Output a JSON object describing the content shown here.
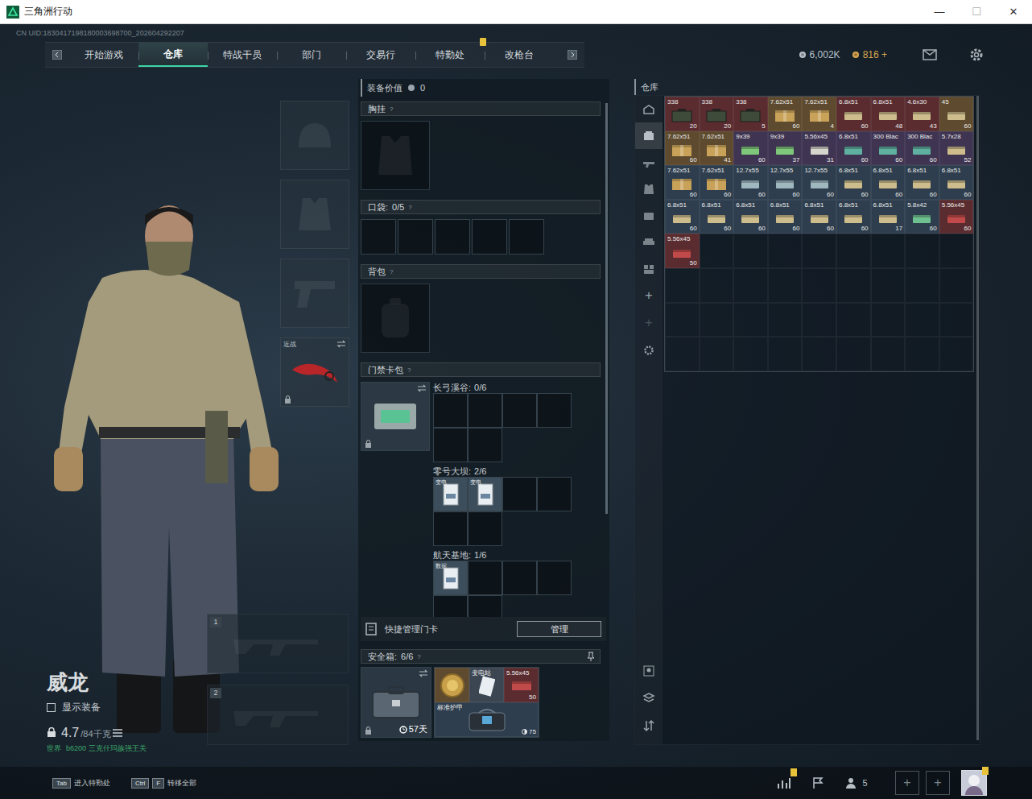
{
  "window": {
    "title": "三角洲行动",
    "controls": {
      "minimize": "—",
      "maximize": "☐",
      "close": "✕"
    }
  },
  "uid": "CN UID:1830417198180003698700_202604292207",
  "nav": {
    "tabs": [
      {
        "label": "开始游戏",
        "selected": false,
        "badge": false
      },
      {
        "label": "仓库",
        "selected": true,
        "badge": false
      },
      {
        "label": "特战干员",
        "selected": false,
        "badge": false
      },
      {
        "label": "部门",
        "selected": false,
        "badge": false
      },
      {
        "label": "交易行",
        "selected": false,
        "badge": false
      },
      {
        "label": "特勤处",
        "selected": false,
        "badge": true
      },
      {
        "label": "改枪台",
        "selected": false,
        "badge": false
      }
    ],
    "currency": [
      {
        "value": "6,002K",
        "color": "#b8c0c8"
      },
      {
        "value": "816 +",
        "color": "#d8a850"
      }
    ]
  },
  "character": {
    "name": "威龙",
    "show_equipment": {
      "label": "显示装备",
      "checked": false
    },
    "weight": "4.7",
    "weight_max": "/84千克",
    "status": {
      "channel": "世界",
      "text": "b6200 三克什玛族强王关"
    },
    "melee": {
      "label": "近战"
    },
    "weapon_slots": [
      "1",
      "2"
    ]
  },
  "loadout": {
    "value_label": "装备价值",
    "value": "0",
    "chest": {
      "label": "胸挂",
      "help": "?"
    },
    "pockets": {
      "label": "口袋:",
      "count": "0/5",
      "help": "?",
      "slots": [
        {
          "filled": false
        },
        {
          "filled": false
        },
        {
          "filled": false
        },
        {
          "filled": false
        },
        {
          "filled": false
        }
      ]
    },
    "backpack": {
      "label": "背包",
      "help": "?"
    },
    "keycards": {
      "label": "门禁卡包",
      "help": "?",
      "maps": [
        {
          "name": "长弓溪谷:",
          "count": "0/6",
          "cards": []
        },
        {
          "name": "零号大坝:",
          "count": "2/6",
          "cards": [
            {
              "label": "变电"
            },
            {
              "label": "变电"
            }
          ]
        },
        {
          "name": "航天基地:",
          "count": "1/6",
          "cards": [
            {
              "label": "数据"
            }
          ]
        }
      ]
    },
    "quick_manage": {
      "label": "快捷管理门卡",
      "button": "管理"
    },
    "safebox": {
      "label": "安全箱:",
      "count": "6/6",
      "help": "?",
      "duration": "57天",
      "items": [
        {
          "kind": "medal"
        },
        {
          "kind": "card",
          "label": "变电站"
        },
        {
          "kind": "ammo",
          "label": "5.56x45",
          "count": "50",
          "color": "#c04a4a"
        },
        {
          "kind": "armor",
          "label": "标准护甲",
          "count": "75"
        }
      ]
    }
  },
  "warehouse": {
    "title": "仓库",
    "sidebar": [
      {
        "selected": false
      },
      {
        "selected": true
      },
      {
        "selected": false
      },
      {
        "selected": false
      },
      {
        "selected": false
      },
      {
        "selected": false
      },
      {
        "selected": false
      }
    ],
    "add_buttons": [
      {
        "glyph": "+",
        "disabled": false
      },
      {
        "glyph": "+",
        "disabled": true
      }
    ],
    "items": [
      {
        "label": "338",
        "count": "20",
        "rarity": "red",
        "kind": "can",
        "color": "#3e4a3a"
      },
      {
        "label": "338",
        "count": "20",
        "rarity": "red",
        "kind": "can",
        "color": "#3e4a3a"
      },
      {
        "label": "338",
        "count": "5",
        "rarity": "red",
        "kind": "can",
        "color": "#3e4a3a"
      },
      {
        "label": "7.62x51",
        "count": "60",
        "rarity": "gold",
        "kind": "crate",
        "color": "#c9a25a"
      },
      {
        "label": "7.62x51",
        "count": "4",
        "rarity": "gold",
        "kind": "crate",
        "color": "#c9a25a"
      },
      {
        "label": "6.8x51",
        "count": "60",
        "rarity": "red",
        "kind": "box",
        "color": "#cdbd8c"
      },
      {
        "label": "6.8x51",
        "count": "48",
        "rarity": "red",
        "kind": "box",
        "color": "#cdbd8c"
      },
      {
        "label": "4.6x30",
        "count": "43",
        "rarity": "red",
        "kind": "box",
        "color": "#cdbd8c"
      },
      {
        "label": "45",
        "count": "60",
        "rarity": "gold",
        "kind": "box",
        "color": "#cdbd8c"
      },
      {
        "label": "7.62x51",
        "count": "60",
        "rarity": "gold",
        "kind": "crate",
        "color": "#c9a25a"
      },
      {
        "label": "7.62x51",
        "count": "41",
        "rarity": "gold",
        "kind": "crate",
        "color": "#c9a25a"
      },
      {
        "label": "9x39",
        "count": "60",
        "rarity": "purple",
        "kind": "box",
        "color": "#7fc77a"
      },
      {
        "label": "9x39",
        "count": "37",
        "rarity": "purple",
        "kind": "box",
        "color": "#7fc77a"
      },
      {
        "label": "5.56x45",
        "count": "31",
        "rarity": "purple",
        "kind": "box",
        "color": "#d6d6cc"
      },
      {
        "label": "6.8x51",
        "count": "60",
        "rarity": "purple",
        "kind": "box",
        "color": "#5fb0a0"
      },
      {
        "label": "300 Blac",
        "count": "60",
        "rarity": "purple",
        "kind": "box",
        "color": "#5fb0a0"
      },
      {
        "label": "300 Blac",
        "count": "60",
        "rarity": "purple",
        "kind": "box",
        "color": "#5fb0a0"
      },
      {
        "label": "5.7x28",
        "count": "52",
        "rarity": "purple",
        "kind": "box",
        "color": "#cdbd8c"
      },
      {
        "label": "7.62x51",
        "count": "60",
        "rarity": "blue",
        "kind": "crate",
        "color": "#c9a25a"
      },
      {
        "label": "7.62x51",
        "count": "60",
        "rarity": "blue",
        "kind": "crate",
        "color": "#c9a25a"
      },
      {
        "label": "12.7x55",
        "count": "60",
        "rarity": "blue",
        "kind": "box",
        "color": "#9fb8c0"
      },
      {
        "label": "12.7x55",
        "count": "60",
        "rarity": "blue",
        "kind": "box",
        "color": "#9fb8c0"
      },
      {
        "label": "12.7x55",
        "count": "60",
        "rarity": "blue",
        "kind": "box",
        "color": "#9fb8c0"
      },
      {
        "label": "6.8x51",
        "count": "60",
        "rarity": "blue",
        "kind": "box",
        "color": "#cdbd8c"
      },
      {
        "label": "6.8x51",
        "count": "60",
        "rarity": "blue",
        "kind": "box",
        "color": "#cdbd8c"
      },
      {
        "label": "6.8x51",
        "count": "60",
        "rarity": "blue",
        "kind": "box",
        "color": "#cdbd8c"
      },
      {
        "label": "6.8x51",
        "count": "60",
        "rarity": "blue",
        "kind": "box",
        "color": "#cdbd8c"
      },
      {
        "label": "6.8x51",
        "count": "60",
        "rarity": "blue",
        "kind": "box",
        "color": "#cdbd8c"
      },
      {
        "label": "6.8x51",
        "count": "60",
        "rarity": "blue",
        "kind": "box",
        "color": "#cdbd8c"
      },
      {
        "label": "6.8x51",
        "count": "60",
        "rarity": "blue",
        "kind": "box",
        "color": "#cdbd8c"
      },
      {
        "label": "6.8x51",
        "count": "60",
        "rarity": "blue",
        "kind": "box",
        "color": "#cdbd8c"
      },
      {
        "label": "6.8x51",
        "count": "60",
        "rarity": "blue",
        "kind": "box",
        "color": "#cdbd8c"
      },
      {
        "label": "6.8x51",
        "count": "60",
        "rarity": "blue",
        "kind": "box",
        "color": "#cdbd8c"
      },
      {
        "label": "6.8x51",
        "count": "17",
        "rarity": "blue",
        "kind": "box",
        "color": "#cdbd8c"
      },
      {
        "label": "5.8x42",
        "count": "60",
        "rarity": "blue",
        "kind": "box",
        "color": "#6fc090"
      },
      {
        "label": "5.56x45",
        "count": "60",
        "rarity": "red",
        "kind": "box",
        "color": "#c04a4a"
      },
      {
        "label": "5.56x45",
        "count": "50",
        "rarity": "red",
        "kind": "box",
        "color": "#c04a4a"
      }
    ]
  },
  "bottom": {
    "hints": [
      {
        "keys": [
          "Tab"
        ],
        "label": "进入特勤处"
      },
      {
        "keys": [
          "Ctrl",
          "F"
        ],
        "label": "转移全部"
      }
    ],
    "stats_badge": true,
    "friends": "5",
    "add_slots": [
      "+",
      "+"
    ],
    "avatar_badge": true
  }
}
